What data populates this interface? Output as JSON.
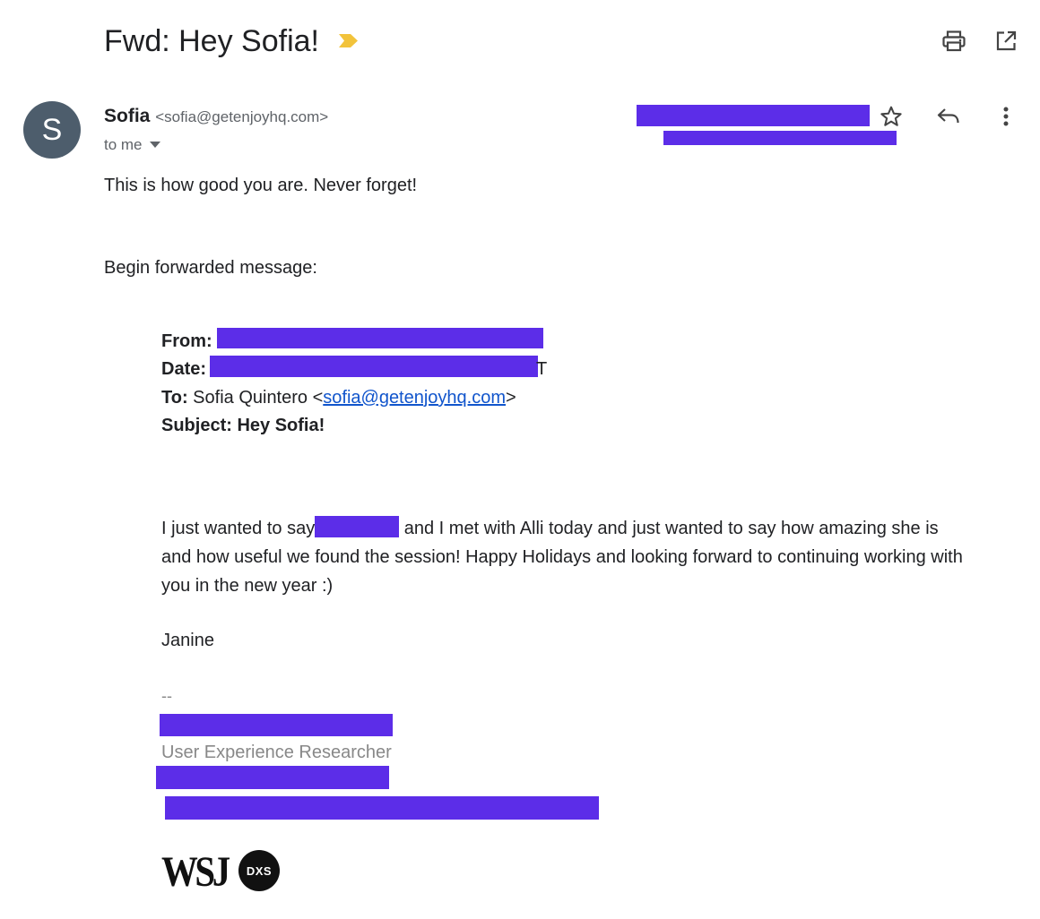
{
  "email": {
    "subject": "Fwd: Hey Sofia!",
    "sender": {
      "avatar_letter": "S",
      "name": "Sofia",
      "email": "<sofia@getenjoyhq.com>",
      "to_label": "to me"
    },
    "intro_line": "This is how good you are. Never forget!",
    "forward_header": "Begin forwarded message:",
    "forwarded": {
      "from_label": "From:",
      "date_label": "Date:",
      "date_trailing": "T",
      "to_label": "To:",
      "to_name": "Sofia Quintero <",
      "to_email": "sofia@getenjoyhq.com",
      "to_close": ">",
      "subject_label": "Subject: Hey Sofia!"
    },
    "message": {
      "part1": "I just wanted to say",
      "part2": " and I met with Alli today and just wanted to say how amazing she is and how useful we found the session! Happy Holidays and looking forward to continuing working with you in the new year :)"
    },
    "signoff": "Janine",
    "signature": {
      "separator": "--",
      "title": "User Experience Researcher"
    },
    "logo": {
      "wsj": "WSJ",
      "badge": "DXS"
    }
  },
  "icons": {
    "label_tag": "importance-marker-icon",
    "print": "print-icon",
    "open_new_window": "open-in-new-window-icon",
    "star": "star-icon",
    "reply": "reply-icon",
    "more": "more-vertical-icon",
    "dropdown": "chevron-down-icon"
  },
  "colors": {
    "redaction": "#5c2de8",
    "avatar": "#4d5d6c",
    "link": "#1155cc",
    "importance": "#f2c33b",
    "signature_grey": "#888888"
  }
}
